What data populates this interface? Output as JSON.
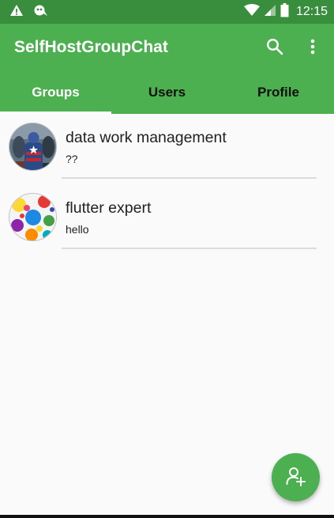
{
  "colors": {
    "status_bar": "#388e3c",
    "primary": "#4caf50",
    "background": "#fafafa",
    "divider": "#dcdcdc"
  },
  "status_bar": {
    "time": "12:15",
    "left_icons": [
      "warning-icon",
      "notification-icon"
    ],
    "right_icons": [
      "wifi-icon",
      "cell-signal-icon",
      "battery-icon"
    ]
  },
  "app_bar": {
    "title": "SelfHostGroupChat",
    "actions": [
      "search-icon",
      "more-vert-icon"
    ]
  },
  "tabs": [
    {
      "label": "Groups",
      "active": true
    },
    {
      "label": "Users",
      "active": false
    },
    {
      "label": "Profile",
      "active": false
    }
  ],
  "groups": [
    {
      "name": "data work management",
      "last_message": "??",
      "avatar": "superhero-group-avatar"
    },
    {
      "name": "flutter expert",
      "last_message": "hello",
      "avatar": "colorful-splash-avatar"
    }
  ],
  "fab": {
    "icon": "add-person-icon"
  }
}
